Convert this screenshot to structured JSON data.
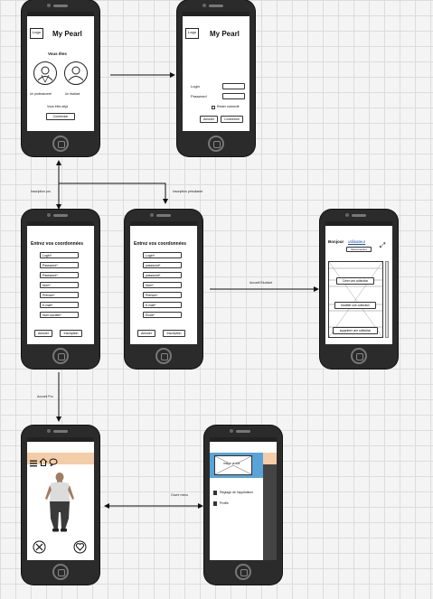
{
  "connectors": {
    "inscription_pro": "Inscription pro",
    "inscription_etudiant": "Inscription pétudiante",
    "accueil_etudiant": "Accueil Etudiant",
    "accueil_pro": "Accueil Pro",
    "ouvrir_menu": "Ouvrir menu"
  },
  "screen_home": {
    "app_title": "My Pearl",
    "logo_text": "Logo",
    "you_are": "Vous êtes",
    "pro_label": "Un professionnel",
    "student_label": "Un étudiant",
    "already": "Vous êtes déjà",
    "connect_button": "Connexion"
  },
  "screen_login": {
    "app_title": "My Pearl",
    "logo_text": "Logo",
    "login_label": "Login",
    "password_label": "Password",
    "remember_label": "Rester connecté",
    "cancel_button": "Annuler",
    "connect_button": "Connexion"
  },
  "screen_register_pro": {
    "heading": "Entrez vos coordonnées",
    "fields": [
      "Login*",
      "Password*",
      "Password*",
      "Nom*",
      "Prénom*",
      "E-mail*",
      "Nom société*"
    ],
    "cancel_button": "Annuler",
    "submit_button": "Inscription"
  },
  "screen_register_student": {
    "heading": "Entrez vos coordonnées",
    "fields": [
      "Login*",
      "password*",
      "password*",
      "Nom*",
      "Prénom*",
      "E-mail*",
      "École*"
    ],
    "cancel_button": "Annuler",
    "submit_button": "Inscription"
  },
  "screen_student_home": {
    "greeting": "Bonjour",
    "user_link": "utilisateur",
    "profile_button": "Déconnexion",
    "create_button": "Créer une collection",
    "edit_button": "Modifier une collection",
    "delete_button": "supprimer une collection"
  },
  "screen_menu": {
    "image_label": "Image profile",
    "item_settings": "Réglage de l'application",
    "item_profile": "Profile"
  },
  "colors": {
    "header_peach": "#f5cca8",
    "menu_blue": "#5aa3d8"
  }
}
